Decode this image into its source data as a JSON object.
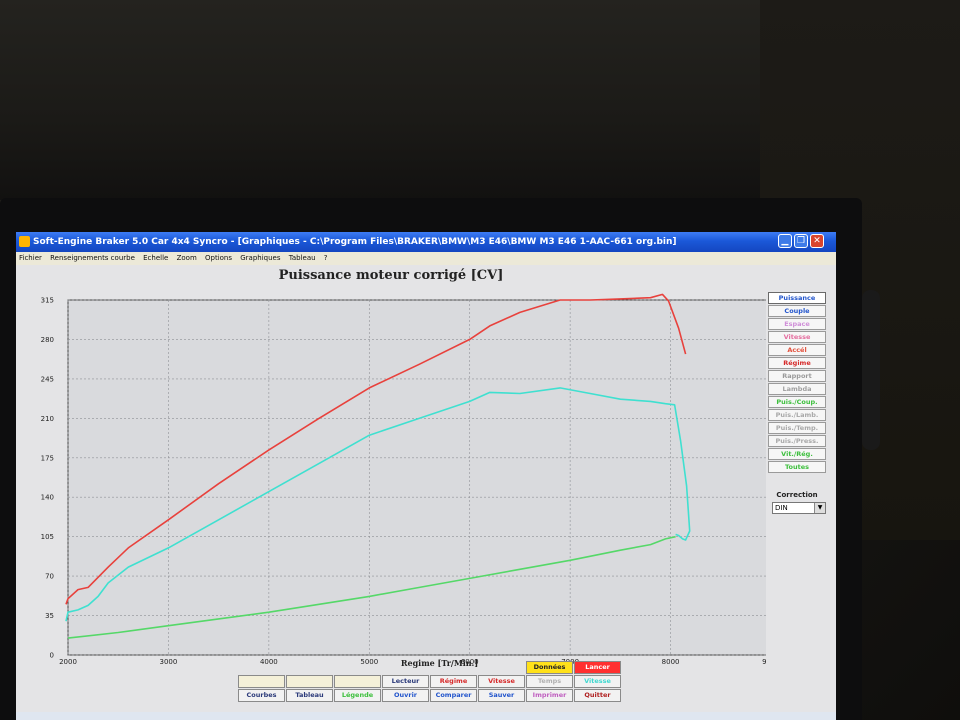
{
  "window": {
    "title": "Soft-Engine Braker 5.0 Car 4x4 Syncro - [Graphiques - C:\\Program Files\\BRAKER\\BMW\\M3 E46\\BMW M3 E46 1-AAC-661 org.bin]",
    "min_glyph": "▁",
    "max_glyph": "❐",
    "close_glyph": "✕"
  },
  "menu": [
    "Fichier",
    "Renseignements courbe",
    "Echelle",
    "Zoom",
    "Options",
    "Graphiques",
    "Tableau",
    "?"
  ],
  "chart_data": {
    "type": "line",
    "title": "Puissance moteur corrigé [CV]",
    "xlabel": "Regime [Tr/Min.]",
    "ylabel": "",
    "xlim": [
      2000,
      9000
    ],
    "ylim": [
      0,
      315
    ],
    "x_ticks": [
      "2000",
      "3000",
      "4000",
      "5000",
      "6000",
      "7000",
      "8000",
      "9000"
    ],
    "y_ticks": [
      "0",
      "35",
      "70",
      "105",
      "140",
      "175",
      "210",
      "245",
      "280",
      "315"
    ],
    "grid": true,
    "series": [
      {
        "color": "#e8413c",
        "x": [
          1980,
          2000,
          2100,
          2200,
          2400,
          2600,
          3000,
          3500,
          4000,
          4500,
          5000,
          5500,
          6000,
          6200,
          6500,
          6900,
          7200,
          7500,
          7800,
          7920,
          7980,
          8080,
          8150
        ],
        "y": [
          45,
          50,
          58,
          60,
          78,
          95,
          120,
          152,
          182,
          210,
          237,
          258,
          280,
          292,
          304,
          315,
          315,
          316,
          317,
          320,
          314,
          290,
          267
        ]
      },
      {
        "color": "#3fe0d0",
        "x": [
          1980,
          2000,
          2100,
          2200,
          2300,
          2400,
          2600,
          3000,
          3500,
          4000,
          4500,
          5000,
          5500,
          6000,
          6200,
          6500,
          6900,
          7200,
          7500,
          7800,
          7950,
          8040,
          8100,
          8160,
          8190,
          8150,
          8120,
          8080,
          8050
        ],
        "y": [
          30,
          38,
          40,
          44,
          52,
          64,
          78,
          95,
          120,
          145,
          170,
          195,
          210,
          225,
          233,
          232,
          237,
          232,
          227,
          225,
          223,
          222,
          190,
          150,
          110,
          102,
          103,
          106,
          107
        ]
      },
      {
        "color": "#55d868",
        "x": [
          2000,
          2500,
          3000,
          3500,
          4000,
          4500,
          5000,
          5500,
          6000,
          6500,
          7000,
          7500,
          7800,
          7950,
          8050
        ],
        "y": [
          15,
          20,
          26,
          32,
          38,
          45,
          52,
          60,
          68,
          76,
          84,
          93,
          98,
          103,
          105
        ]
      }
    ]
  },
  "side_menu": [
    {
      "label": "Puissance",
      "color": "#2255cc",
      "active": true
    },
    {
      "label": "Couple",
      "color": "#2255cc",
      "active": false
    },
    {
      "label": "Espace",
      "color": "#d08fd8",
      "active": false
    },
    {
      "label": "Vitesse",
      "color": "#e56fa0",
      "active": false
    },
    {
      "label": "Accél",
      "color": "#e2503c",
      "active": false
    },
    {
      "label": "Régime",
      "color": "#d62a2a",
      "active": false
    },
    {
      "label": "Rapport",
      "color": "#9a9a9a",
      "active": false
    },
    {
      "label": "Lambda",
      "color": "#a0a0a0",
      "active": false
    },
    {
      "label": "Puis./Coup.",
      "color": "#3cbf3c",
      "active": false
    },
    {
      "label": "Puis./Lamb.",
      "color": "#a8a8a8",
      "active": false
    },
    {
      "label": "Puis./Temp.",
      "color": "#a8a8a8",
      "active": false
    },
    {
      "label": "Puis./Press.",
      "color": "#a8a8a8",
      "active": false
    },
    {
      "label": "Vit./Rég.",
      "color": "#3cbf3c",
      "active": false
    },
    {
      "label": "Toutes",
      "color": "#3cbf3c",
      "active": false
    }
  ],
  "correction": {
    "label": "Correction",
    "value": "DIN",
    "arrow": "▼"
  },
  "bottom_buttons": {
    "row1": [
      {
        "label": "Données",
        "bg": "#ffe11a",
        "color": "#222222"
      },
      {
        "label": "Lancer",
        "bg": "#ff3030",
        "color": "#ffffff"
      }
    ],
    "row2": [
      {
        "label": "",
        "bg": "#f4f0d8",
        "color": "#e0c860"
      },
      {
        "label": "",
        "bg": "#f4f0d8",
        "color": "#e0c860"
      },
      {
        "label": "",
        "bg": "#f4f0d8",
        "color": "#e0c860"
      },
      {
        "label": "Lecteur",
        "bg": "#f2f2f2",
        "color": "#2b3a7a"
      },
      {
        "label": "Régime",
        "bg": "#f2f2f2",
        "color": "#d62a2a"
      },
      {
        "label": "Vitesse",
        "bg": "#f2f2f2",
        "color": "#d62a2a"
      },
      {
        "label": "Temps",
        "bg": "#f2f2f2",
        "color": "#b0b0b0"
      },
      {
        "label": "Vitesse",
        "bg": "#f2f2f2",
        "color": "#40d8d0"
      }
    ],
    "row3": [
      {
        "label": "Courbes",
        "bg": "#f2f2f2",
        "color": "#2b3a7a"
      },
      {
        "label": "Tableau",
        "bg": "#f2f2f2",
        "color": "#2b3a7a"
      },
      {
        "label": "Légende",
        "bg": "#f2f2f2",
        "color": "#3cbf3c"
      },
      {
        "label": "Ouvrir",
        "bg": "#f2f2f2",
        "color": "#2255cc"
      },
      {
        "label": "Comparer",
        "bg": "#f2f2f2",
        "color": "#2255cc"
      },
      {
        "label": "Sauver",
        "bg": "#f2f2f2",
        "color": "#2255cc"
      },
      {
        "label": "Imprimer",
        "bg": "#f2f2f2",
        "color": "#c060c0"
      },
      {
        "label": "Quitter",
        "bg": "#f2f2f2",
        "color": "#b02020"
      }
    ]
  }
}
